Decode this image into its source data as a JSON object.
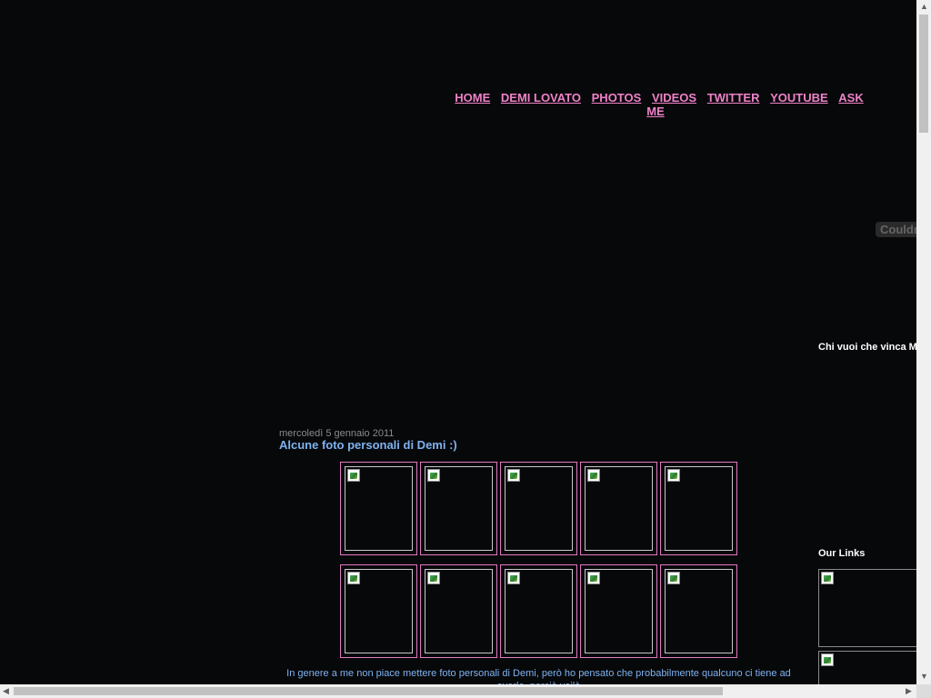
{
  "nav": {
    "items": [
      "HOME",
      "DEMI LOVATO",
      "PHOTOS",
      "VIDEOS",
      "TWITTER",
      "YOUTUBE",
      "ASK ME"
    ]
  },
  "sidebar": {
    "widget_text": "Couldn",
    "poll_title": "Chi vuoi che vinca M",
    "links_title": "Our Links"
  },
  "post": {
    "date": "mercoledì 5 gennaio 2011",
    "title": "Alcune foto personali di Demi :)",
    "body": "In genere a me non piace mettere foto personali di Demi, però ho pensato che probabilmente qualcuno ci tiene ad averle, perciò voilà"
  },
  "colors": {
    "background": "#07080a",
    "nav_link": "#ee82c8",
    "post_title": "#7fb2f0",
    "thumb_border": "#e07ac0"
  },
  "icons": {
    "broken_image": "broken-image-icon",
    "scroll_up": "arrow-up-icon",
    "scroll_down": "arrow-down-icon",
    "scroll_left": "arrow-left-icon",
    "scroll_right": "arrow-right-icon"
  }
}
